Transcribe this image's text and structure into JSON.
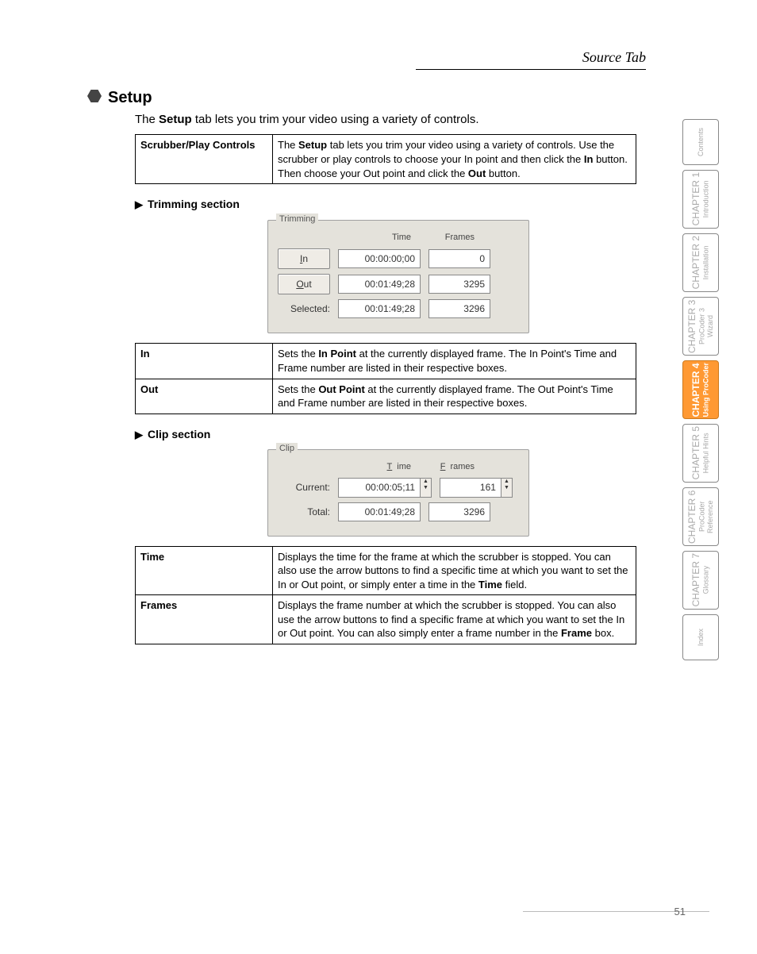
{
  "header": {
    "source_tab": "Source Tab",
    "page_number": "51"
  },
  "setup": {
    "title": "Setup",
    "lead_1": "The ",
    "lead_2": "Setup",
    "lead_3": " tab lets you trim your video using a variety of controls.",
    "table": {
      "r1_label": "Scrubber/Play Controls",
      "r1_a": "The ",
      "r1_b": "Setup",
      "r1_c": " tab lets you trim your video using a variety of controls. Use the scrubber or play controls to choose your In point and then click the ",
      "r1_d": "In",
      "r1_e": " button. Then choose your Out point and click the ",
      "r1_f": "Out",
      "r1_g": " button."
    }
  },
  "trimming": {
    "heading": "Trimming section",
    "panel": {
      "legend": "Trimming",
      "col_time": "Time",
      "col_frames": "Frames",
      "in_btn": "In",
      "in_time": "00:00:00;00",
      "in_frames": "0",
      "out_btn": "Out",
      "out_time": "00:01:49;28",
      "out_frames": "3295",
      "sel_label": "Selected:",
      "sel_time": "00:01:49;28",
      "sel_frames": "3296"
    },
    "table": {
      "r1_label": "In",
      "r1_a": "Sets the ",
      "r1_b": "In Point",
      "r1_c": " at the currently displayed frame. The In Point's Time and Frame number are listed in their respective boxes.",
      "r2_label": "Out",
      "r2_a": "Sets the ",
      "r2_b": "Out Point",
      "r2_c": " at the currently displayed frame. The Out Point's Time and Frame number are listed in their respective boxes."
    }
  },
  "clip": {
    "heading": "Clip section",
    "panel": {
      "legend": "Clip",
      "col_time": "Time",
      "col_frames": "Frames",
      "cur_label": "Current:",
      "cur_time": "00:00:05;11",
      "cur_frames": "161",
      "tot_label": "Total:",
      "tot_time": "00:01:49;28",
      "tot_frames": "3296"
    },
    "table": {
      "r1_label": "Time",
      "r1_a": "Displays the time for the frame at which the scrubber is stopped. You can also use the arrow buttons to find a specific time at which you want to set the In or Out point, or simply enter a time in the ",
      "r1_b": "Time",
      "r1_c": " field.",
      "r2_label": "Frames",
      "r2_a": "Displays the frame number at which the scrubber is stopped. You can also use the arrow buttons to find a specific frame at which you want to set the In or Out point. You can also simply enter a frame number in the ",
      "r2_b": "Frame",
      "r2_c": " box."
    }
  },
  "nav": {
    "contents": "Contents",
    "tabs": [
      {
        "ch": "CHAPTER 1",
        "sub": "Introduction"
      },
      {
        "ch": "CHAPTER 2",
        "sub": "Installation"
      },
      {
        "ch": "CHAPTER 3",
        "sub": "ProCoder 3 Wizard"
      },
      {
        "ch": "CHAPTER 4",
        "sub": "Using ProCoder"
      },
      {
        "ch": "CHAPTER 5",
        "sub": "Helpful Hints"
      },
      {
        "ch": "CHAPTER 6",
        "sub": "ProCoder Reference"
      },
      {
        "ch": "CHAPTER 7",
        "sub": "Glossary"
      }
    ],
    "index": "Index"
  }
}
